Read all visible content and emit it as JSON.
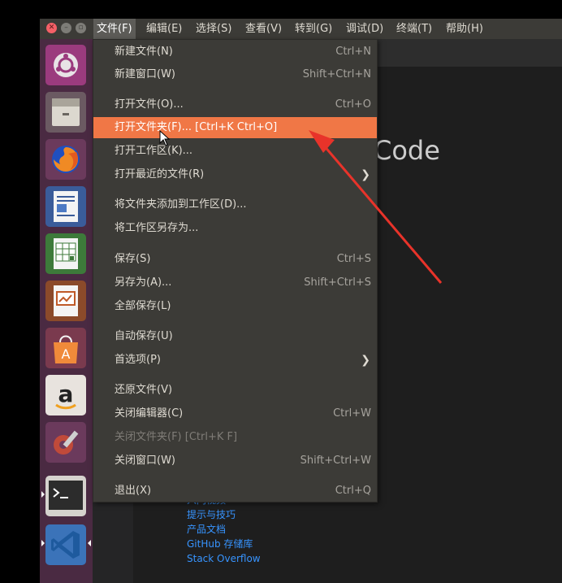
{
  "menubar": {
    "items": [
      {
        "label": "文件(F)",
        "active": true
      },
      {
        "label": "编辑(E)"
      },
      {
        "label": "选择(S)"
      },
      {
        "label": "查看(V)"
      },
      {
        "label": "转到(G)"
      },
      {
        "label": "调试(D)"
      },
      {
        "label": "终端(T)"
      },
      {
        "label": "帮助(H)"
      }
    ]
  },
  "file_menu": {
    "items": [
      {
        "label": "新建文件(N)",
        "shortcut": "Ctrl+N"
      },
      {
        "label": "新建窗口(W)",
        "shortcut": "Shift+Ctrl+N"
      },
      {
        "label": "打开文件(O)...",
        "shortcut": "Ctrl+O"
      },
      {
        "label": "打开文件夹(F)... [Ctrl+K Ctrl+O]",
        "shortcut": "",
        "highlighted": true
      },
      {
        "label": "打开工作区(K)...",
        "shortcut": ""
      },
      {
        "label": "打开最近的文件(R)",
        "shortcut": "",
        "submenu": true
      },
      {
        "label": "将文件夹添加到工作区(D)...",
        "shortcut": ""
      },
      {
        "label": "将工作区另存为...",
        "shortcut": ""
      },
      {
        "label": "保存(S)",
        "shortcut": "Ctrl+S"
      },
      {
        "label": "另存为(A)...",
        "shortcut": "Shift+Ctrl+S"
      },
      {
        "label": "全部保存(L)",
        "shortcut": ""
      },
      {
        "label": "自动保存(U)",
        "shortcut": ""
      },
      {
        "label": "首选项(P)",
        "shortcut": "",
        "submenu": true
      },
      {
        "label": "还原文件(V)",
        "shortcut": ""
      },
      {
        "label": "关闭编辑器(C)",
        "shortcut": "Ctrl+W"
      },
      {
        "label": "关闭文件夹(F) [Ctrl+K F]",
        "shortcut": "",
        "disabled": true
      },
      {
        "label": "关闭窗口(W)",
        "shortcut": "Shift+Ctrl+W"
      },
      {
        "label": "退出(X)",
        "shortcut": "Ctrl+Q"
      }
    ],
    "submenu_glyph": "❯"
  },
  "welcome": {
    "title_fragment": "Code",
    "links": [
      "入门视频",
      "提示与技巧",
      "产品文档",
      "GitHub 存储库",
      "Stack Overflow"
    ]
  },
  "launcher": {
    "apps": [
      {
        "name": "ubuntu-dash-icon"
      },
      {
        "name": "files-icon"
      },
      {
        "name": "firefox-icon"
      },
      {
        "name": "writer-icon"
      },
      {
        "name": "calc-icon"
      },
      {
        "name": "impress-icon"
      },
      {
        "name": "software-center-icon"
      },
      {
        "name": "amazon-icon"
      },
      {
        "name": "settings-icon"
      },
      {
        "name": "terminal-icon"
      },
      {
        "name": "vscode-icon"
      }
    ]
  },
  "colors": {
    "menu_bg": "#3c3b37",
    "highlight": "#f07746",
    "launcher_bg": "#4a2a42",
    "annotation": "#e8332a",
    "link": "#3794ff"
  }
}
